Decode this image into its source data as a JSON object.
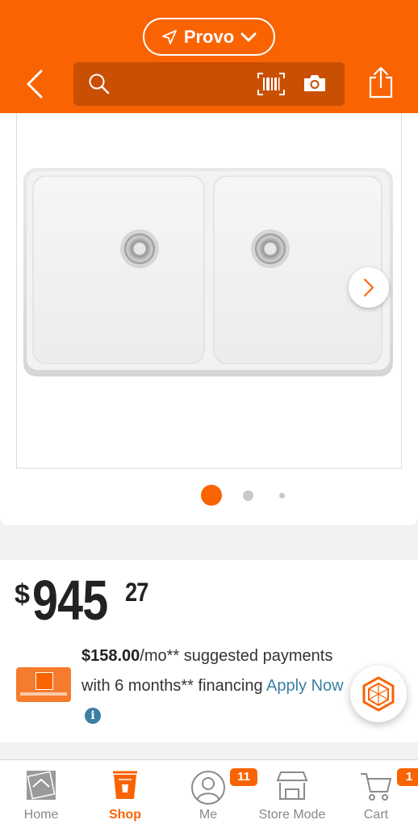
{
  "header": {
    "location": "Provo",
    "search_placeholder": ""
  },
  "gallery": {
    "product_image_alt": "White double-bowl farmhouse sink",
    "dots": 3,
    "active_dot": 1
  },
  "price": {
    "symbol": "$",
    "dollars": "945",
    "cents": "27"
  },
  "financing": {
    "monthly_amount": "$158.00",
    "line1_rest": "/mo** suggested payments",
    "line2_text": "with 6 months** financing ",
    "apply_link": "Apply Now"
  },
  "bottom_nav": {
    "items": [
      {
        "label": "Home"
      },
      {
        "label": "Shop"
      },
      {
        "label": "Me"
      },
      {
        "label": "Store Mode"
      },
      {
        "label": "Cart"
      }
    ],
    "active": "Shop",
    "me_badge": "11",
    "cart_badge": "1"
  },
  "colors": {
    "brand_orange": "#f96302",
    "link_blue": "#3b7fa3"
  }
}
